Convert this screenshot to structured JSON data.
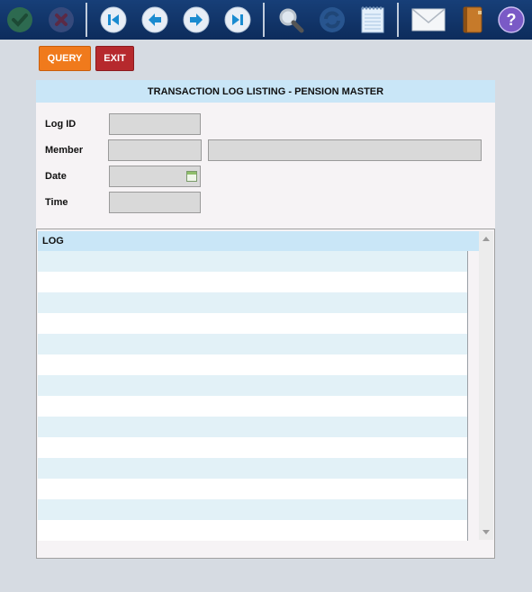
{
  "toolbar": {
    "icons": [
      "accept-check-icon",
      "cancel-x-icon",
      "first-record-icon",
      "previous-record-icon",
      "next-record-icon",
      "last-record-icon",
      "search-magnifier-icon",
      "refresh-icon",
      "notepad-icon",
      "mail-envelope-icon",
      "address-book-icon",
      "help-question-icon"
    ]
  },
  "buttons": {
    "query_label": "QUERY",
    "exit_label": "EXIT"
  },
  "form": {
    "title": "TRANSACTION LOG LISTING - PENSION MASTER",
    "log_id_label": "Log ID",
    "log_id_value": "",
    "member_label": "Member",
    "member_code_value": "",
    "member_name_value": "",
    "date_label": "Date",
    "date_value": "",
    "time_label": "Time",
    "time_value": ""
  },
  "grid": {
    "column_header": "LOG",
    "rows": []
  },
  "colors": {
    "toolbar_bg": "#11356b",
    "query_button": "#f07a1c",
    "exit_button": "#b6292d",
    "header_blue": "#c9e6f7",
    "row_alt": "#e2f1f7"
  }
}
